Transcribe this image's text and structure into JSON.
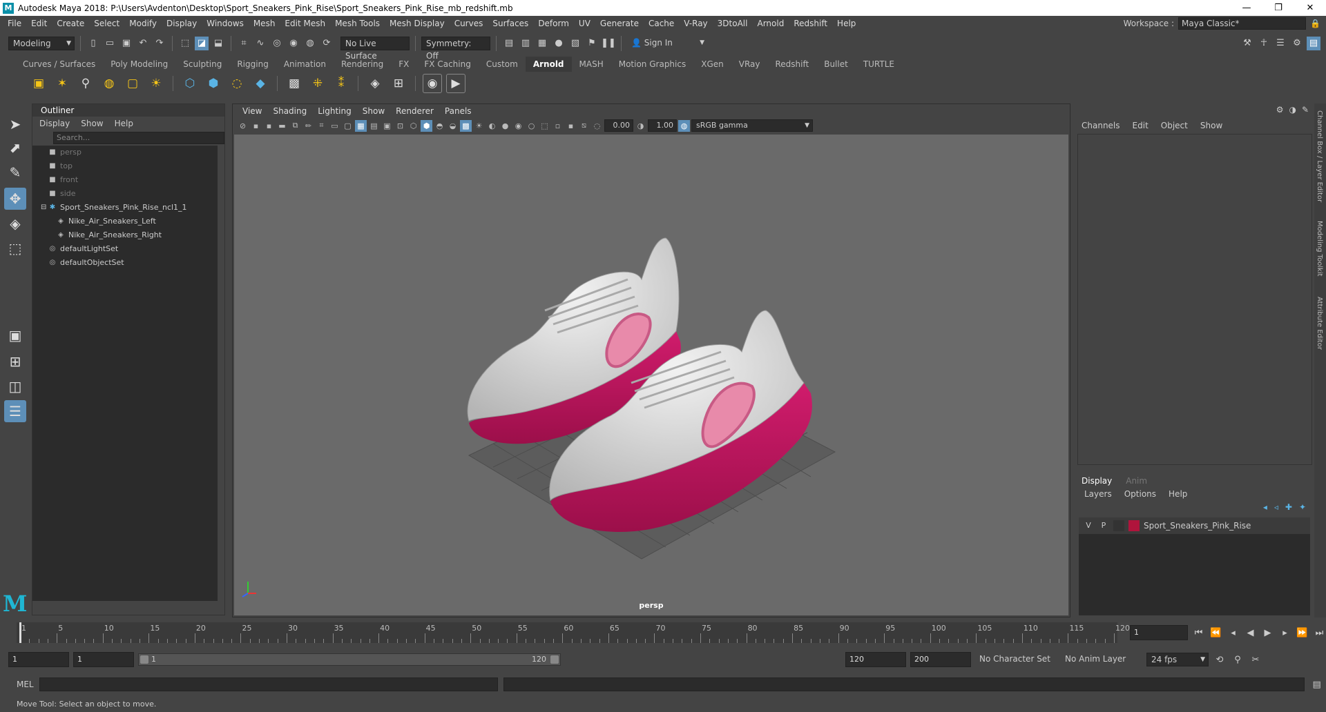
{
  "titlebar": {
    "title": "Autodesk Maya 2018: P:\\Users\\Avdenton\\Desktop\\Sport_Sneakers_Pink_Rise\\Sport_Sneakers_Pink_Rise_mb_redshift.mb",
    "logo": "M",
    "minimize": "—",
    "maximize": "❐",
    "close": "✕"
  },
  "menubar": {
    "items": [
      "File",
      "Edit",
      "Create",
      "Select",
      "Modify",
      "Display",
      "Windows",
      "Mesh",
      "Edit Mesh",
      "Mesh Tools",
      "Mesh Display",
      "Curves",
      "Surfaces",
      "Deform",
      "UV",
      "Generate",
      "Cache",
      "V-Ray",
      "3DtoAll",
      "Arnold",
      "Redshift",
      "Help"
    ],
    "workspace_label": "Workspace :",
    "workspace_value": "Maya Classic*"
  },
  "statusline": {
    "mode": "Modeling",
    "live_surface": "No Live Surface",
    "symmetry": "Symmetry: Off",
    "sign_in": "Sign In"
  },
  "shelf": {
    "tabs": [
      "Curves / Surfaces",
      "Poly Modeling",
      "Sculpting",
      "Rigging",
      "Animation",
      "Rendering",
      "FX",
      "FX Caching",
      "Custom",
      "Arnold",
      "MASH",
      "Motion Graphics",
      "XGen",
      "VRay",
      "Redshift",
      "Bullet",
      "TURTLE"
    ],
    "active_tab": "Arnold"
  },
  "outliner": {
    "title": "Outliner",
    "menu": [
      "Display",
      "Show",
      "Help"
    ],
    "search_placeholder": "Search...",
    "items": [
      {
        "label": "persp",
        "indent": 0,
        "type": "camera",
        "dim": true
      },
      {
        "label": "top",
        "indent": 0,
        "type": "camera",
        "dim": true
      },
      {
        "label": "front",
        "indent": 0,
        "type": "camera",
        "dim": true
      },
      {
        "label": "side",
        "indent": 0,
        "type": "camera",
        "dim": true
      },
      {
        "label": "Sport_Sneakers_Pink_Rise_ncl1_1",
        "indent": 0,
        "type": "group",
        "expanded": true
      },
      {
        "label": "Nike_Air_Sneakers_Left",
        "indent": 1,
        "type": "mesh"
      },
      {
        "label": "Nike_Air_Sneakers_Right",
        "indent": 1,
        "type": "mesh"
      },
      {
        "label": "defaultLightSet",
        "indent": 0,
        "type": "set"
      },
      {
        "label": "defaultObjectSet",
        "indent": 0,
        "type": "set"
      }
    ]
  },
  "viewport": {
    "menu": [
      "View",
      "Shading",
      "Lighting",
      "Show",
      "Renderer",
      "Panels"
    ],
    "exposure": "0.00",
    "gamma": "1.00",
    "color_space": "sRGB gamma",
    "camera": "persp"
  },
  "channelbox": {
    "menu": [
      "Channels",
      "Edit",
      "Object",
      "Show"
    ]
  },
  "layereditor": {
    "tabs": [
      "Display",
      "Anim"
    ],
    "active_tab": "Display",
    "menu": [
      "Layers",
      "Options",
      "Help"
    ],
    "layer": {
      "v": "V",
      "p": "P",
      "name": "Sport_Sneakers_Pink_Rise",
      "color": "#b0143c"
    }
  },
  "sidebar_tabs": [
    "Channel Box / Layer Editor",
    "Modeling Toolkit",
    "Attribute Editor"
  ],
  "timeslider": {
    "ticks": [
      "1",
      "5",
      "10",
      "15",
      "20",
      "25",
      "30",
      "35",
      "40",
      "45",
      "50",
      "55",
      "60",
      "65",
      "70",
      "75",
      "80",
      "85",
      "90",
      "95",
      "100",
      "105",
      "110",
      "115",
      "120"
    ],
    "current_frame": "1"
  },
  "range": {
    "start": "1",
    "anim_start": "1",
    "range_start_label": "1",
    "range_end_label": "120",
    "anim_end": "120",
    "end": "200",
    "character_set": "No Character Set",
    "anim_layer": "No Anim Layer",
    "fps": "24 fps"
  },
  "cmdline": {
    "label": "MEL"
  },
  "helpline": {
    "text": "Move Tool: Select an object to move."
  },
  "colors": {
    "accent": "#5d8fb8",
    "sole": "#c2185b",
    "upper": "#d8d8d8",
    "maya_logo": "#1fb6d3"
  }
}
